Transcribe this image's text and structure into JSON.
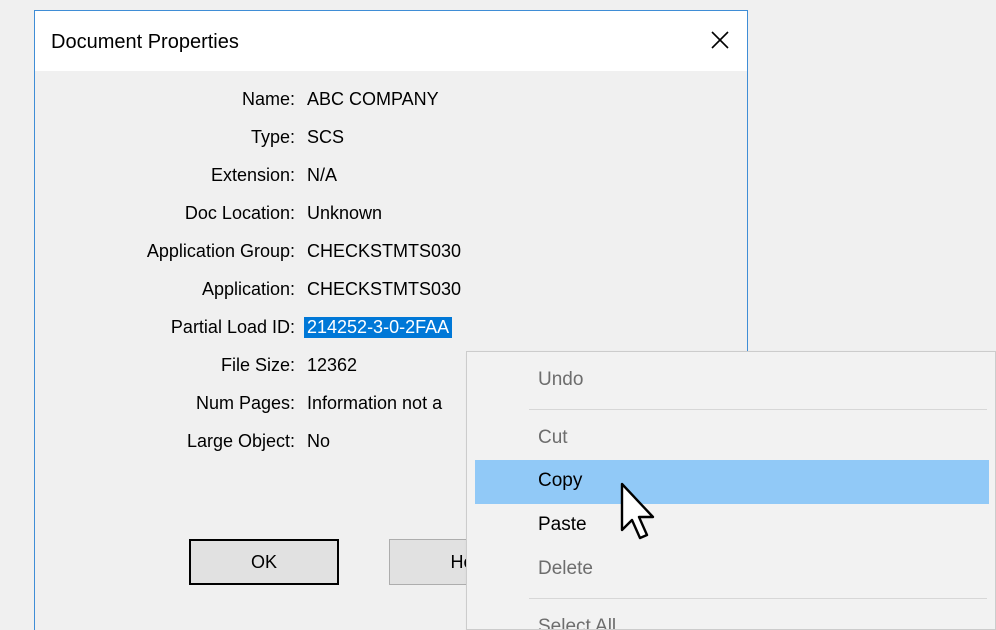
{
  "dialog": {
    "title": "Document Properties",
    "properties": [
      {
        "label": "Name:",
        "value": "ABC COMPANY"
      },
      {
        "label": "Type:",
        "value": "SCS"
      },
      {
        "label": "Extension:",
        "value": "N/A"
      },
      {
        "label": "Doc Location:",
        "value": "Unknown"
      },
      {
        "label": "Application Group:",
        "value": "CHECKSTMTS030"
      },
      {
        "label": "Application:",
        "value": "CHECKSTMTS030"
      },
      {
        "label": "Partial Load ID:",
        "value": "214252-3-0-2FAA"
      },
      {
        "label": "File Size:",
        "value": "12362"
      },
      {
        "label": "Num Pages:",
        "value": "Information not a"
      },
      {
        "label": "Large Object:",
        "value": "No"
      }
    ],
    "ok_label": "OK",
    "help_label": "Hel"
  },
  "context_menu": {
    "items": [
      {
        "label": "Undo",
        "enabled": false
      },
      {
        "label": "Cut",
        "enabled": false
      },
      {
        "label": "Copy",
        "enabled": true,
        "highlighted": true
      },
      {
        "label": "Paste",
        "enabled": true
      },
      {
        "label": "Delete",
        "enabled": false
      },
      {
        "label": "Select All",
        "enabled": false
      }
    ]
  },
  "colors": {
    "selection": "#0078d7",
    "menu_highlight": "#91c9f7",
    "dialog_border": "#3f8dd6"
  },
  "icons": [
    "close-icon",
    "mouse-pointer-icon"
  ]
}
